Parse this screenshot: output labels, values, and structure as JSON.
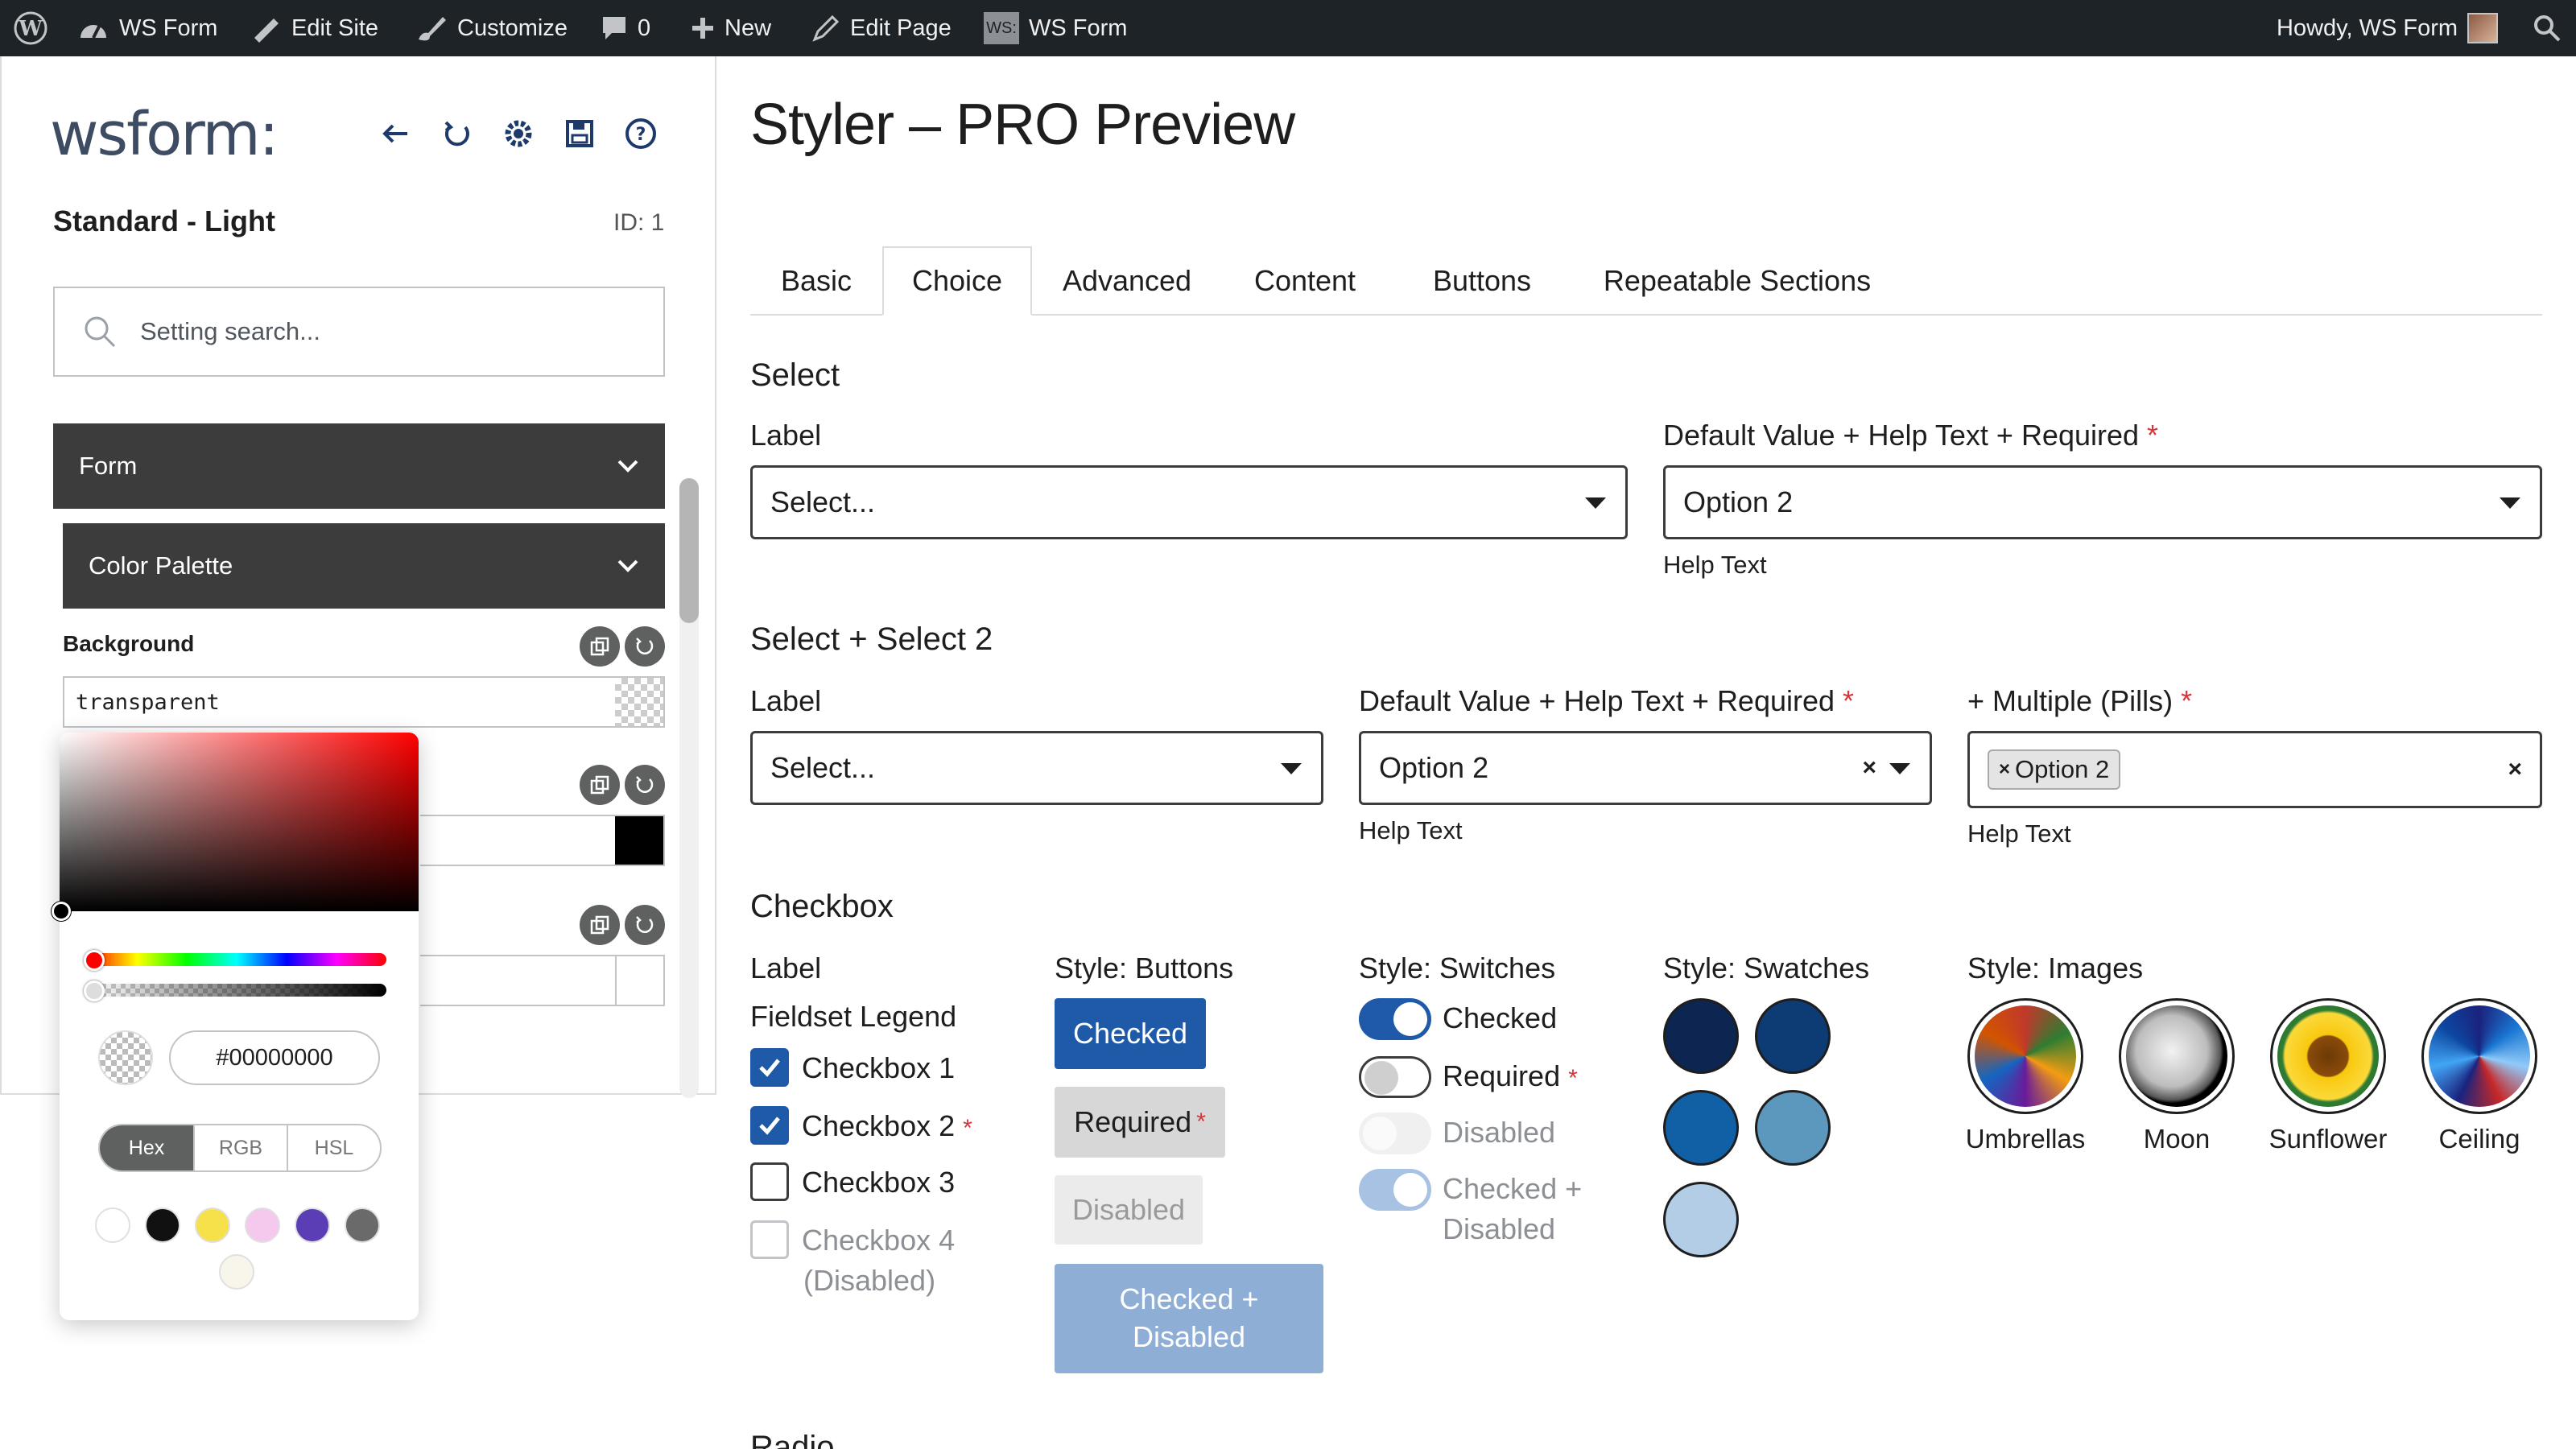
{
  "admin_bar": {
    "site_name": "WS Form",
    "edit_site": "Edit Site",
    "customize": "Customize",
    "comments_count": "0",
    "new_label": "New",
    "edit_page": "Edit Page",
    "ws_form_menu": "WS Form",
    "ws_badge": "WS:",
    "greeting": "Howdy, WS Form"
  },
  "sidebar": {
    "logo": "wsform:",
    "style_name": "Standard - Light",
    "style_id": "ID: 1",
    "search_placeholder": "Setting search...",
    "accordion_form": "Form",
    "accordion_palette": "Color Palette",
    "background_label": "Background",
    "background_value": "transparent"
  },
  "color_picker": {
    "hex_value": "#00000000",
    "modes": [
      "Hex",
      "RGB",
      "HSL"
    ],
    "active_mode": "Hex",
    "swatches": [
      "#ffffff",
      "#111111",
      "#f7e14b",
      "#f5c8ee",
      "#5b3db6",
      "#6a6a6a",
      "#f8f5ea"
    ]
  },
  "main": {
    "page_title": "Styler – PRO Preview",
    "tabs": [
      "Basic",
      "Choice",
      "Advanced",
      "Content",
      "Buttons",
      "Repeatable Sections"
    ],
    "active_tab": "Choice",
    "select_section": {
      "title": "Select",
      "label1": "Label",
      "placeholder1": "Select...",
      "label2": "Default Value + Help Text + Required",
      "value2": "Option 2",
      "help2": "Help Text"
    },
    "select2_section": {
      "title": "Select + Select 2",
      "label1": "Label",
      "placeholder1": "Select...",
      "label2": "Default Value + Help Text + Required",
      "value2": "Option 2",
      "help2": "Help Text",
      "label3": "+ Multiple (Pills)",
      "pill3": "Option 2",
      "help3": "Help Text",
      "required_mark": "*"
    },
    "checkbox_section": {
      "title": "Checkbox",
      "col_label": "Label",
      "fieldset_legend": "Fieldset Legend",
      "checkboxes": [
        "Checkbox 1",
        "Checkbox 2",
        "Checkbox 3",
        "Checkbox 4",
        "(Disabled)"
      ],
      "buttons_title": "Style: Buttons",
      "btn_checked": "Checked",
      "btn_required": "Required",
      "btn_disabled": "Disabled",
      "btn_checked_disabled_1": "Checked +",
      "btn_checked_disabled_2": "Disabled",
      "switches_title": "Style: Switches",
      "sw_checked": "Checked",
      "sw_required": "Required",
      "sw_disabled": "Disabled",
      "sw_checked_disabled_1": "Checked +",
      "sw_checked_disabled_2": "Disabled",
      "swatches_title": "Style: Swatches",
      "swatch_colors": [
        "#0c2551",
        "#0d3b73",
        "#1160a6",
        "#5c97be",
        "#b3cde6"
      ],
      "images_title": "Style: Images",
      "images": [
        "Umbrellas",
        "Moon",
        "Sunflower",
        "Ceiling"
      ]
    },
    "radio_section": {
      "title": "Radio"
    }
  },
  "colors": {
    "admin_bar_bg": "#1d2327",
    "accent_blue": "#1f5aa8",
    "required_red": "#d63638",
    "dark_panel": "#3c3c3c"
  }
}
